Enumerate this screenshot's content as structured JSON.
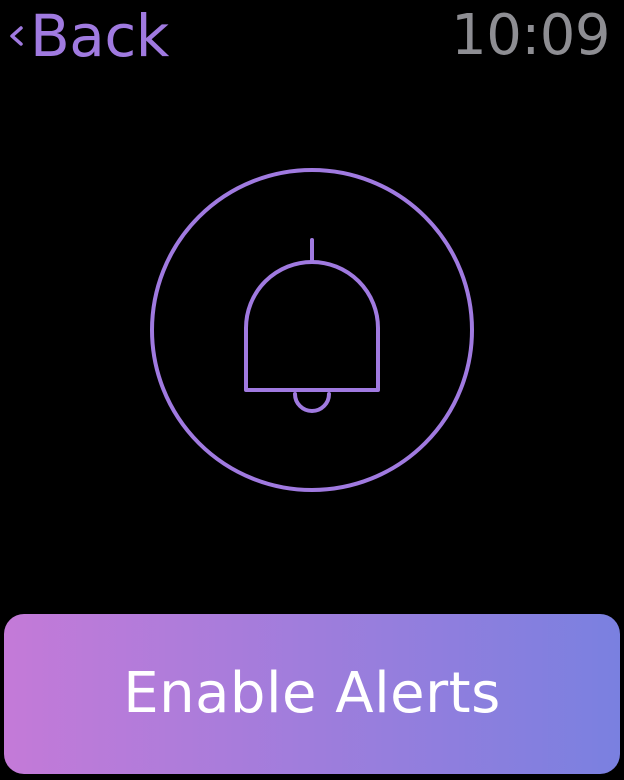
{
  "header": {
    "back_label": "Back",
    "back_icon": "chevron-left-icon",
    "time": "10:09"
  },
  "main": {
    "icon": "bell-icon"
  },
  "action": {
    "label": "Enable Alerts"
  },
  "colors": {
    "background": "#000000",
    "accent": "#a07ae0",
    "clock": "#8e8e93",
    "button_text": "#ffffff",
    "button_gradient_start": "#c47ad8",
    "button_gradient_end": "#7a80e0"
  }
}
